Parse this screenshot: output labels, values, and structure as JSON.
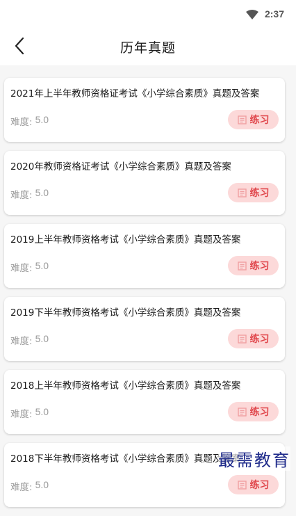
{
  "status_bar": {
    "time": "2:37",
    "wifi_icon": "wifi-icon"
  },
  "header": {
    "title": "历年真题",
    "back_icon": "chevron-left-icon"
  },
  "exams": [
    {
      "title": "2021年上半年教师资格证考试《小学综合素质》真题及答案",
      "difficulty_label": "难度:",
      "difficulty": "5.0",
      "button_label": "练习"
    },
    {
      "title": "2020年教师资格证考试《小学综合素质》真题及答案",
      "difficulty_label": "难度:",
      "difficulty": "5.0",
      "button_label": "练习"
    },
    {
      "title": "2019上半年教师资格考试《小学综合素质》真题及答案",
      "difficulty_label": "难度:",
      "difficulty": "5.0",
      "button_label": "练习"
    },
    {
      "title": "2019下半年教师资格考试《小学综合素质》真题及答案",
      "difficulty_label": "难度:",
      "difficulty": "5.0",
      "button_label": "练习"
    },
    {
      "title": "2018上半年教师资格考试《小学综合素质》真题及答案",
      "difficulty_label": "难度:",
      "difficulty": "5.0",
      "button_label": "练习"
    },
    {
      "title": "2018下半年教师资格考试《小学综合素质》真题及答案",
      "difficulty_label": "难度:",
      "difficulty": "5.0",
      "button_label": "练习"
    }
  ],
  "watermark": "最需教育",
  "colors": {
    "accent": "#e0474c",
    "button_bg": "#fcd9d9",
    "background": "#f6f6f6"
  }
}
